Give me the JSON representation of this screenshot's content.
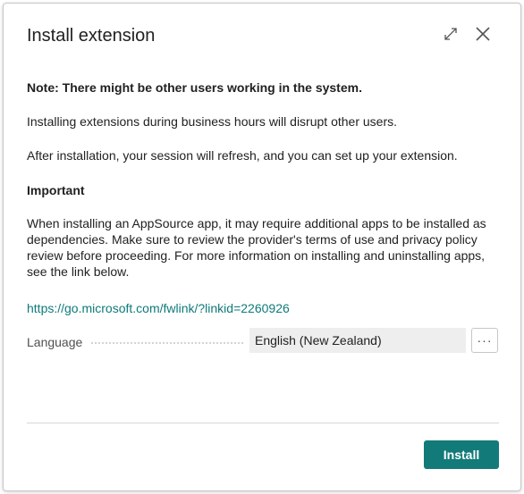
{
  "dialog": {
    "title": "Install extension",
    "expand_icon": "expand-diagonal-icon",
    "close_icon": "close-icon"
  },
  "content": {
    "note": "Note: There might be other users working in the system.",
    "disrupt": "Installing extensions during business hours will disrupt other users.",
    "refresh": "After installation, your session will refresh, and you can set up your extension.",
    "important_heading": "Important",
    "important_text": "When installing an AppSource app, it may require additional apps to be installed as dependencies. Make sure to review the provider's terms of use and privacy policy review before proceeding. For more information on installing and uninstalling apps, see the link below.",
    "link": "https://go.microsoft.com/fwlink/?linkid=2260926"
  },
  "language": {
    "label": "Language",
    "value": "English (New Zealand)",
    "more_label": "···"
  },
  "footer": {
    "install_label": "Install"
  },
  "colors": {
    "accent": "#137a7a",
    "link": "#0e7a7a"
  }
}
